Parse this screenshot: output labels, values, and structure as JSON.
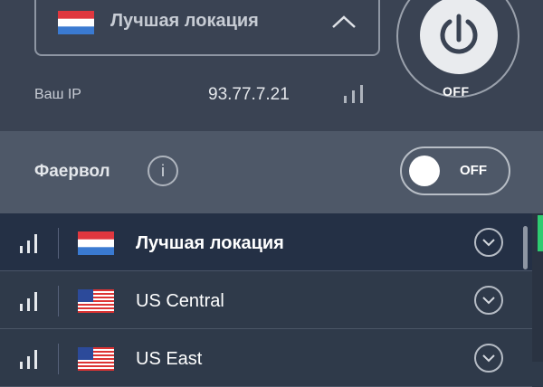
{
  "location_select": {
    "label": "Лучшая локация",
    "flag": "netherlands-flag-icon",
    "chevron": "chevron-up-icon"
  },
  "ip": {
    "label": "Ваш IP",
    "value": "93.77.7.21",
    "signal_icon": "signal-bars-icon"
  },
  "power": {
    "icon": "power-icon",
    "state": "OFF"
  },
  "firewall": {
    "label": "Фаервол",
    "info_glyph": "i",
    "toggle_state": "OFF"
  },
  "locations": [
    {
      "name": "Лучшая локация",
      "flag": "netherlands-flag-icon",
      "selected": true
    },
    {
      "name": "US Central",
      "flag": "usa-flag-icon",
      "selected": false
    },
    {
      "name": "US East",
      "flag": "usa-flag-icon",
      "selected": false
    }
  ],
  "colors": {
    "panel": "#3a4353",
    "firewall_bar": "#4e5868",
    "list_bg": "#2f3a4a",
    "selected_row": "#243045",
    "accent_green": "#2ecc71"
  }
}
